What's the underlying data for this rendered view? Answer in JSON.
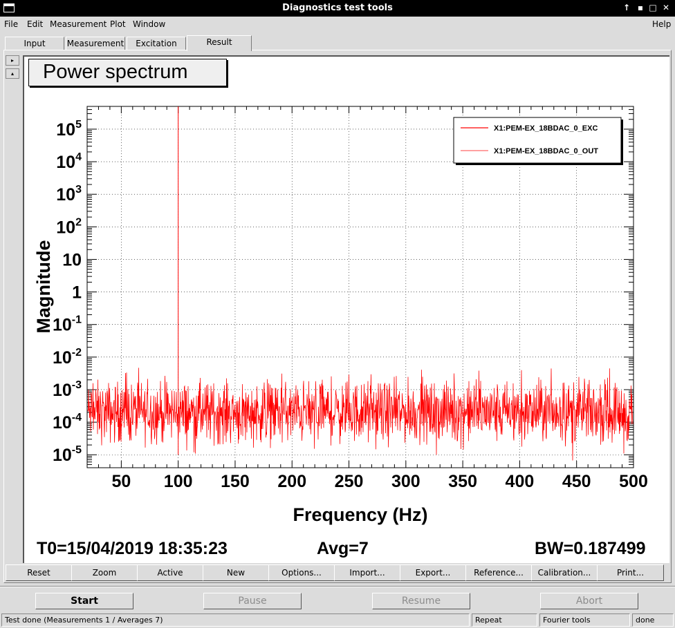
{
  "window": {
    "title": "Diagnostics test tools",
    "controls": [
      "↑",
      "▪",
      "□",
      "✕"
    ]
  },
  "menubar": {
    "left": [
      "File",
      "Edit",
      "Measurement",
      "Plot",
      "Window"
    ],
    "right": "Help"
  },
  "tabs": [
    "Input",
    "Measurement",
    "Excitation",
    "Result"
  ],
  "active_tab": "Result",
  "side_arrows": [
    "▸",
    "▴"
  ],
  "plot": {
    "title": "Power spectrum",
    "footer": {
      "t0": "T0=15/04/2019 18:35:23",
      "avg": "Avg=7",
      "bw": "BW=0.187499"
    }
  },
  "chart_data": {
    "type": "line",
    "xlabel": "Frequency (Hz)",
    "ylabel": "Magnitude",
    "xlim": [
      20,
      500
    ],
    "ylim": [
      4e-06,
      500000
    ],
    "yscale": "log",
    "grid": true,
    "legend_position": "top-right",
    "x_ticks": [
      50,
      100,
      150,
      200,
      250,
      300,
      350,
      400,
      450,
      500
    ],
    "y_ticks": [
      {
        "base": "10",
        "exp": "5",
        "value": 100000
      },
      {
        "base": "10",
        "exp": "4",
        "value": 10000
      },
      {
        "base": "10",
        "exp": "3",
        "value": 1000
      },
      {
        "base": "10",
        "exp": "2",
        "value": 100
      },
      {
        "base": "10",
        "exp": "",
        "value": 10
      },
      {
        "base": "1",
        "exp": "",
        "value": 1
      },
      {
        "base": "10",
        "exp": "-1",
        "value": 0.1
      },
      {
        "base": "10",
        "exp": "-2",
        "value": 0.01
      },
      {
        "base": "10",
        "exp": "-3",
        "value": 0.001
      },
      {
        "base": "10",
        "exp": "-4",
        "value": 0.0001
      },
      {
        "base": "10",
        "exp": "-5",
        "value": 1e-05
      }
    ],
    "series": [
      {
        "name": "X1:PEM-EX_18BDAC_0_EXC",
        "color": "#ff0000",
        "kind": "peak",
        "x": 100,
        "peak": 500000,
        "floor": 1e-05
      },
      {
        "name": "X1:PEM-EX_18BDAC_0_OUT",
        "color": "#ff0000",
        "kind": "noise",
        "x_range": [
          20,
          500
        ],
        "median": 0.0002,
        "min": 5e-06,
        "max": 0.005
      }
    ]
  },
  "toolbar": [
    "Reset",
    "Zoom",
    "Active",
    "New",
    "Options...",
    "Import...",
    "Export...",
    "Reference...",
    "Calibration...",
    "Print..."
  ],
  "controls": [
    {
      "label": "Start",
      "enabled": true
    },
    {
      "label": "Pause",
      "enabled": false
    },
    {
      "label": "Resume",
      "enabled": false
    },
    {
      "label": "Abort",
      "enabled": false
    }
  ],
  "status": {
    "message": "Test done (Measurements 1 / Averages 7)",
    "mode": "Repeat",
    "tool": "Fourier tools",
    "blank": "",
    "state": "done"
  }
}
